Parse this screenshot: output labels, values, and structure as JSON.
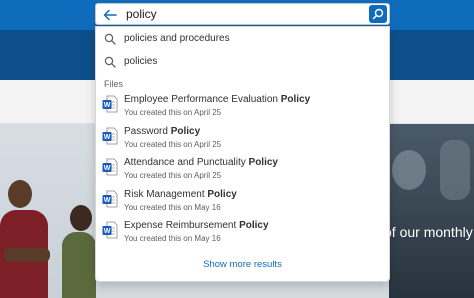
{
  "search": {
    "value": "policy",
    "placeholder": ""
  },
  "suggestions": [
    {
      "text": "policies and procedures"
    },
    {
      "text": "policies"
    }
  ],
  "files_section_label": "Files",
  "files": [
    {
      "name": "Employee Performance Evaluation ",
      "match": "Policy",
      "sub": "You created this on April 25"
    },
    {
      "name": "Password ",
      "match": "Policy",
      "sub": "You created this on April 25"
    },
    {
      "name": "Attendance and Punctuality ",
      "match": "Policy",
      "sub": "You created this on April 25"
    },
    {
      "name": "Risk Management ",
      "match": "Policy",
      "sub": "You created this on May 16"
    },
    {
      "name": "Expense Reimbursement ",
      "match": "Policy",
      "sub": "You created this on May 16"
    }
  ],
  "show_more": "Show more results",
  "hero": {
    "text": "of our monthly"
  },
  "colors": {
    "accent": "#0f6cbd",
    "band": "#0d4f8a",
    "word_blue": "#185abd"
  }
}
